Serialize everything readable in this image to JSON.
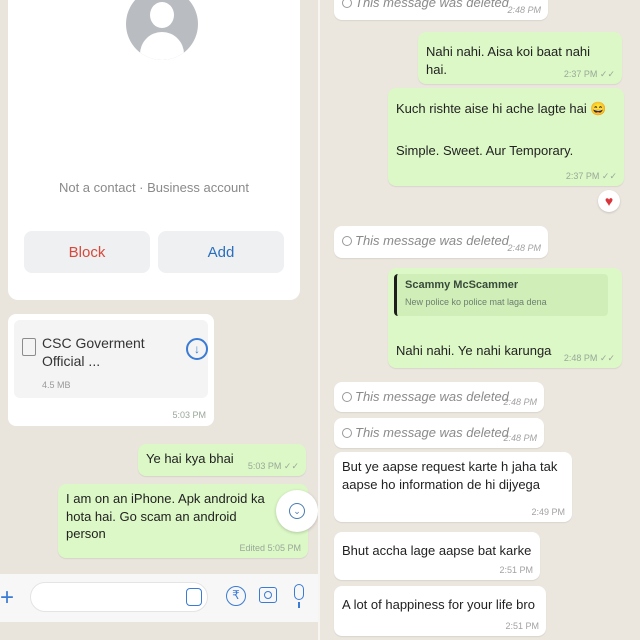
{
  "left": {
    "contact_info": "Not a contact · Business account",
    "block_label": "Block",
    "add_label": "Add",
    "document": {
      "name": "CSC Goverment Official ...",
      "size": "4.5 MB",
      "time": "5:03 PM"
    },
    "messages": [
      {
        "text": "Ye hai kya bhai",
        "time": "5:03 PM ✓✓"
      },
      {
        "text": "I am on an iPhone. Apk android ka hota hai. Go scam an android person",
        "time": "Edited 5:05 PM"
      }
    ],
    "input_placeholder": "",
    "rupee_symbol": "₹"
  },
  "right": {
    "messages": [
      {
        "kind": "deleted",
        "text": "This message was deleted",
        "time": "2:48 PM"
      },
      {
        "kind": "out",
        "text": "Nahi nahi. Aisa koi baat nahi hai.",
        "time": "2:37 PM ✓✓"
      },
      {
        "kind": "out",
        "text": "Kuch rishte aise hi ache lagte hai 😄",
        "text2": "Simple. Sweet. Aur Temporary.",
        "time": "2:37 PM ✓✓"
      },
      {
        "kind": "deleted",
        "text": "This message was deleted",
        "time": "2:48 PM"
      },
      {
        "kind": "reply",
        "quote_author": "Scammy McScammer",
        "quote_text": "New police ko police mat laga dena",
        "text": "Nahi nahi. Ye nahi karunga",
        "time": "2:48 PM ✓✓"
      },
      {
        "kind": "deleted",
        "text": "This message was deleted",
        "time": "2:48 PM"
      },
      {
        "kind": "deleted",
        "text": "This message was deleted",
        "time": "2:48 PM"
      },
      {
        "kind": "in",
        "text": "But ye aapse request karte h jaha tak aapse ho information de hi dijyega",
        "time": "2:49 PM"
      },
      {
        "kind": "in",
        "text": "Bhut accha lage aapse bat karke",
        "time": "2:51 PM"
      },
      {
        "kind": "in",
        "text": "A lot of happiness for your life bro",
        "time": "2:51 PM"
      }
    ],
    "reaction": "♥"
  },
  "colors": {
    "outgoing_bubble": "#dcf8c6",
    "incoming_bubble": "#ffffff",
    "accent": "#3a7bd5",
    "block_red": "#d64a3c"
  },
  "icons": [
    "avatar-placeholder",
    "document-icon",
    "download-icon",
    "scroll-down-icon",
    "plus-icon",
    "sticker-icon",
    "rupee-icon",
    "camera-icon",
    "mic-icon",
    "deleted-icon"
  ]
}
